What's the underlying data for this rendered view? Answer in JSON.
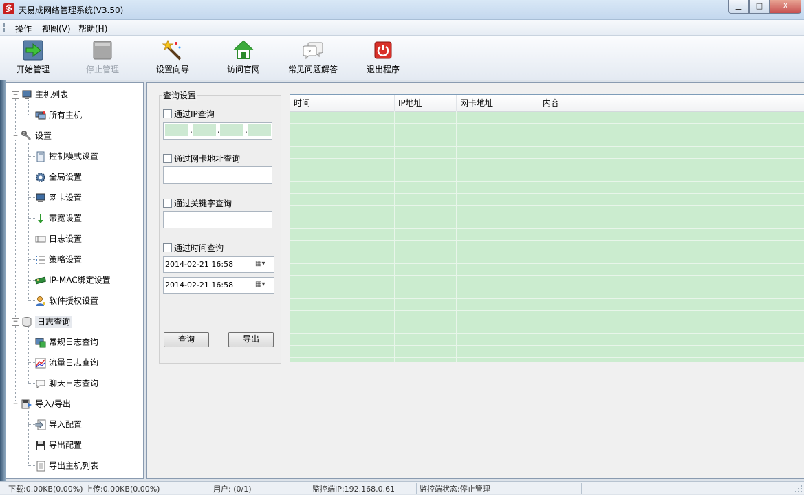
{
  "window": {
    "title": "天易成网络管理系统(V3.50)",
    "app_icon_glyph": "多",
    "minimize_glyph": "▁",
    "maximize_glyph": "□",
    "close_glyph": "X"
  },
  "menu": {
    "items": [
      {
        "label": "操作"
      },
      {
        "label": "视图(V)"
      },
      {
        "label": "帮助(H)"
      }
    ]
  },
  "toolbar": {
    "items": [
      {
        "label": "开始管理",
        "icon": "start-arrow-icon",
        "enabled": true
      },
      {
        "label": "停止管理",
        "icon": "stop-square-icon",
        "enabled": false
      },
      {
        "label": "设置向导",
        "icon": "magic-wand-icon",
        "enabled": true
      },
      {
        "label": "访问官网",
        "icon": "home-icon",
        "enabled": true
      },
      {
        "label": "常见问题解答",
        "icon": "question-bubble-icon",
        "enabled": true
      },
      {
        "label": "退出程序",
        "icon": "power-icon",
        "enabled": true
      }
    ]
  },
  "tree": {
    "expander_glyph": "−",
    "nodes": [
      {
        "label": "主机列表",
        "icon": "computer-icon",
        "level": 0
      },
      {
        "label": "所有主机",
        "icon": "hosts-icon",
        "level": 1
      },
      {
        "label": "设置",
        "icon": "wrench-icon",
        "level": 0
      },
      {
        "label": "控制模式设置",
        "icon": "panel-icon",
        "level": 1
      },
      {
        "label": "全局设置",
        "icon": "gear-icon",
        "level": 1
      },
      {
        "label": "网卡设置",
        "icon": "monitor-icon",
        "level": 1
      },
      {
        "label": "带宽设置",
        "icon": "down-arrow-icon",
        "level": 1
      },
      {
        "label": "日志设置",
        "icon": "log-icon",
        "level": 1
      },
      {
        "label": "策略设置",
        "icon": "list-icon",
        "level": 1
      },
      {
        "label": "IP-MAC绑定设置",
        "icon": "network-card-icon",
        "level": 1
      },
      {
        "label": "软件授权设置",
        "icon": "user-key-icon",
        "level": 1
      },
      {
        "label": "日志查询",
        "icon": "database-icon",
        "level": 0,
        "selected": true
      },
      {
        "label": "常规日志查询",
        "icon": "log-screen-icon",
        "level": 1
      },
      {
        "label": "流量日志查询",
        "icon": "chart-icon",
        "level": 1
      },
      {
        "label": "聊天日志查询",
        "icon": "chat-icon",
        "level": 1
      },
      {
        "label": "导入/导出",
        "icon": "import-export-icon",
        "level": 0
      },
      {
        "label": "导入配置",
        "icon": "import-icon",
        "level": 1
      },
      {
        "label": "导出配置",
        "icon": "floppy-icon",
        "level": 1
      },
      {
        "label": "导出主机列表",
        "icon": "document-icon",
        "level": 1
      }
    ]
  },
  "query": {
    "group_title": "查询设置",
    "by_ip_label": "通过IP查询",
    "by_mac_label": "通过网卡地址查询",
    "by_keyword_label": "通过关键字查询",
    "by_time_label": "通过时间查询",
    "ip_dot": ".",
    "start_time": "2014-02-21 16:58",
    "end_time": "2014-02-21 16:58",
    "calendar_glyph": "▦▾",
    "query_button": "查询",
    "export_button": "导出"
  },
  "grid": {
    "columns": [
      "时间",
      "IP地址",
      "网卡地址",
      "内容"
    ],
    "rows": []
  },
  "statusbar": {
    "traffic": "下载:0.00KB(0.00%) 上传:0.00KB(0.00%)",
    "users": "用户: (0/1)",
    "monitor_ip": "监控端IP:192.168.0.61",
    "monitor_state": "监控端状态:停止管理"
  },
  "colors": {
    "grid_background": "#cbeccf",
    "title_gradient_top": "#d9e8f6",
    "close_button": "#c75050"
  }
}
